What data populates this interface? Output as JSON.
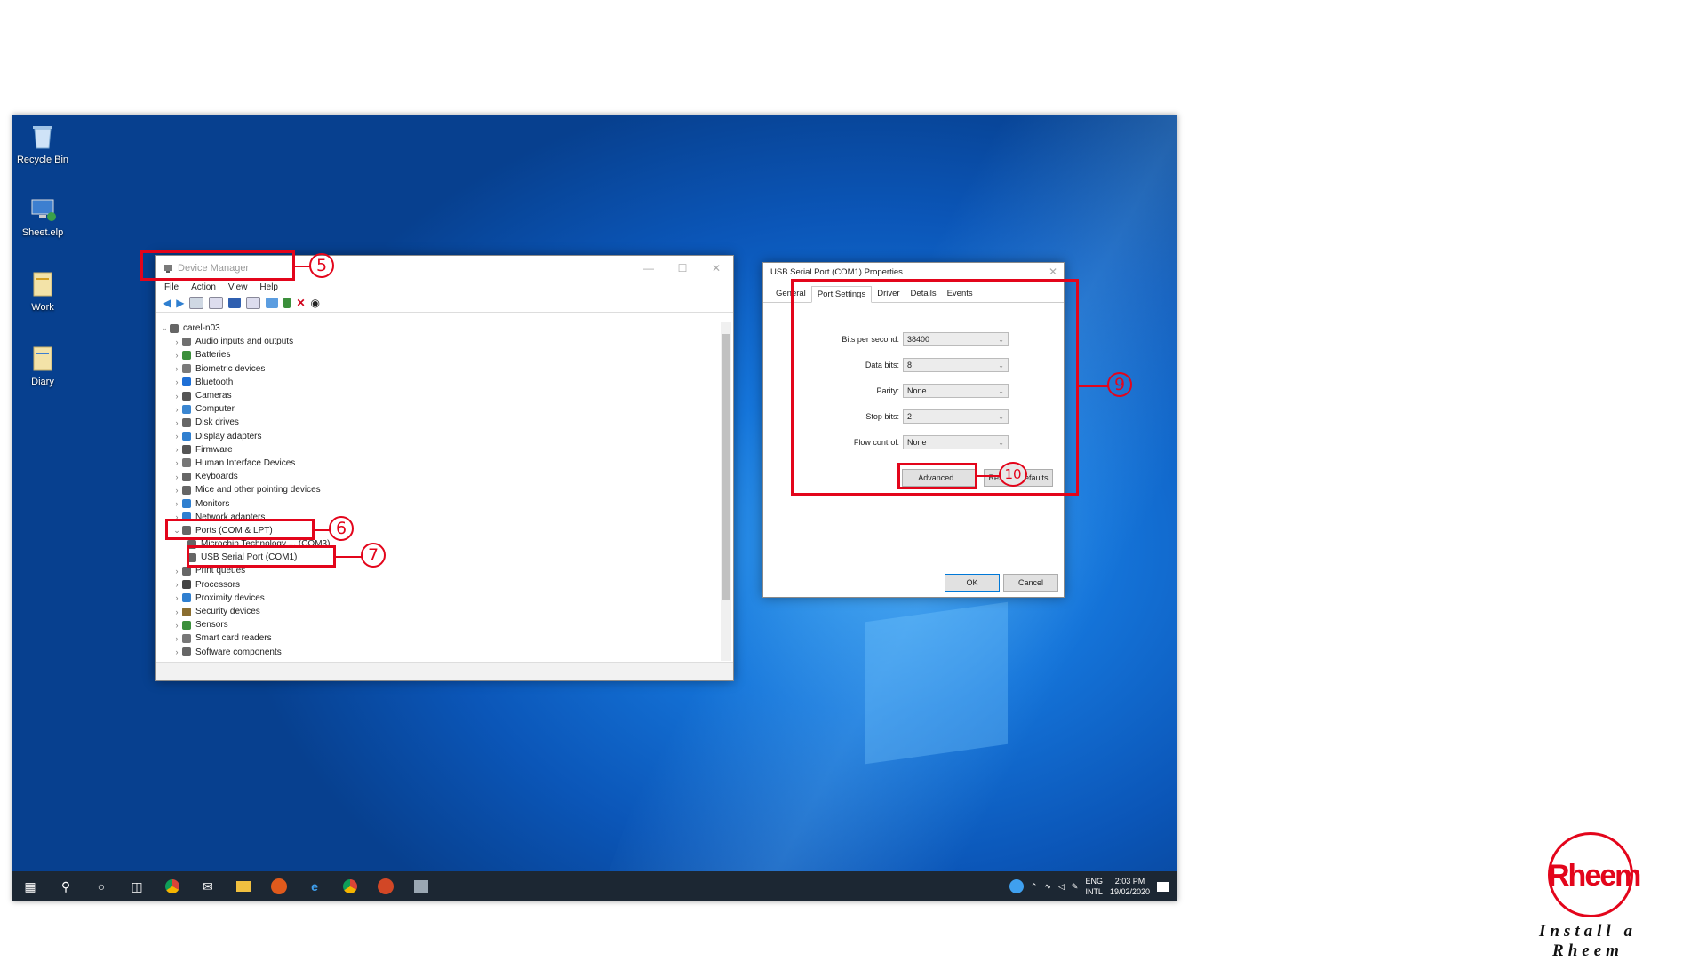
{
  "desktop": {
    "icons": [
      {
        "label": "Recycle Bin",
        "icon": "recycle-bin-icon"
      },
      {
        "label": "Sheet.elp",
        "icon": "computer-icon"
      },
      {
        "label": "Work",
        "icon": "folder-icon"
      },
      {
        "label": "Diary",
        "icon": "folder-icon"
      }
    ]
  },
  "device_manager": {
    "title": "Device Manager",
    "window_controls": [
      "—",
      "☐",
      "✕"
    ],
    "menu": [
      "File",
      "Action",
      "View",
      "Help"
    ],
    "root": "carel-n03",
    "items": [
      {
        "label": "Audio inputs and outputs",
        "color": "#6f6f6f"
      },
      {
        "label": "Batteries",
        "color": "#3b8f3b"
      },
      {
        "label": "Biometric devices",
        "color": "#7a7a7a"
      },
      {
        "label": "Bluetooth",
        "color": "#1e6fd6"
      },
      {
        "label": "Cameras",
        "color": "#555555"
      },
      {
        "label": "Computer",
        "color": "#3a86d1"
      },
      {
        "label": "Disk drives",
        "color": "#666666"
      },
      {
        "label": "Display adapters",
        "color": "#2f7fd0"
      },
      {
        "label": "Firmware",
        "color": "#555555"
      },
      {
        "label": "Human Interface Devices",
        "color": "#777777"
      },
      {
        "label": "Keyboards",
        "color": "#666666"
      },
      {
        "label": "Mice and other pointing devices",
        "color": "#666666"
      },
      {
        "label": "Monitors",
        "color": "#2f7fd0"
      },
      {
        "label": "Network adapters",
        "color": "#2f7fd0"
      },
      {
        "label": "Ports (COM & LPT)",
        "color": "#666666"
      },
      {
        "label": "Microchip Technology ... (COM3)",
        "color": "#666666",
        "child": true
      },
      {
        "label": "USB Serial Port (COM1)",
        "color": "#666666",
        "child": true
      },
      {
        "label": "Print queues",
        "color": "#666666"
      },
      {
        "label": "Processors",
        "color": "#444444"
      },
      {
        "label": "Proximity devices",
        "color": "#2f7fd0"
      },
      {
        "label": "Security devices",
        "color": "#8a6d2f"
      },
      {
        "label": "Sensors",
        "color": "#3b8f3b"
      },
      {
        "label": "Smart card readers",
        "color": "#777777"
      },
      {
        "label": "Software components",
        "color": "#666666"
      }
    ]
  },
  "properties": {
    "title": "USB Serial Port (COM1) Properties",
    "close": "✕",
    "tabs": [
      "General",
      "Port Settings",
      "Driver",
      "Details",
      "Events"
    ],
    "active_tab": "Port Settings",
    "settings": [
      {
        "label": "Bits per second:",
        "value": "38400"
      },
      {
        "label": "Data bits:",
        "value": "8"
      },
      {
        "label": "Parity:",
        "value": "None"
      },
      {
        "label": "Stop bits:",
        "value": "2"
      },
      {
        "label": "Flow control:",
        "value": "None"
      }
    ],
    "advanced_label": "Advanced...",
    "restore_label": "Restore Defaults",
    "ok_label": "OK",
    "cancel_label": "Cancel"
  },
  "callouts": [
    "5",
    "6",
    "7",
    "9",
    "10"
  ],
  "taskbar": {
    "tray_lang": "ENG",
    "tray_layout": "INTL",
    "time": "2:03 PM",
    "date": "19/02/2020"
  },
  "logo": {
    "word": "Rheem",
    "tagline": "Install a Rheem"
  },
  "colors": {
    "accent_red": "#e3051b",
    "taskbar": "#1c2733",
    "desktop_blue": "#1575da"
  }
}
